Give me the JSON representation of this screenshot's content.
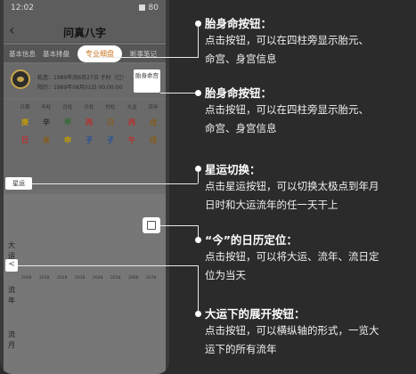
{
  "status": {
    "time": "12:02",
    "battery": "■ 80"
  },
  "nav": {
    "back": "‹",
    "title": "问真八字"
  },
  "tabs": [
    "基本信息",
    "基本排盘",
    "专业细盘",
    "断事笔记"
  ],
  "profile": {
    "line1": "乾造：1989年闰6月27日 子时（巳）",
    "line2": "阳历：1989年08月01日 00:00:00"
  },
  "buttons": {
    "taiming": "胎身命宫",
    "xingyun": "星运",
    "expand": "<"
  },
  "grid": {
    "headers": [
      "日期",
      "年柱",
      "月柱",
      "日柱",
      "时柱",
      "大运",
      "流年"
    ],
    "gan": [
      "庚",
      "辛",
      "甲",
      "丙",
      "己",
      "丙",
      "戊"
    ],
    "zhi": [
      "巳",
      "未",
      "申",
      "子",
      "子",
      "午",
      "戌"
    ]
  },
  "lower": {
    "side_labels": [
      "大",
      "运",
      "流",
      "年",
      "流",
      "月"
    ],
    "years": [
      "2008",
      "2018",
      "2028",
      "2038",
      "2048",
      "2058",
      "2068",
      "2078"
    ]
  },
  "annotations": [
    {
      "title": "胎身命按钮：",
      "desc": [
        "点击按钮，可以在四柱旁显示胎元、",
        "命宫、身宫信息"
      ]
    },
    {
      "title": "胎身命按钮：",
      "desc": [
        "点击按钮，可以在四柱旁显示胎元、",
        "命宫、身宫信息"
      ]
    },
    {
      "title": "星运切换：",
      "desc": [
        "点击星运按钮，可以切换太极点到年月",
        "日时和大运流年的任一天干上"
      ]
    },
    {
      "title": "“今”的日历定位：",
      "desc": [
        "点击按钮，可以将大运、流年、流日定",
        "位为当天"
      ]
    },
    {
      "title": "大运下的展开按钮：",
      "desc": [
        "点击按钮，可以横纵轴的形式，一览大",
        "运下的所有流年"
      ]
    }
  ]
}
